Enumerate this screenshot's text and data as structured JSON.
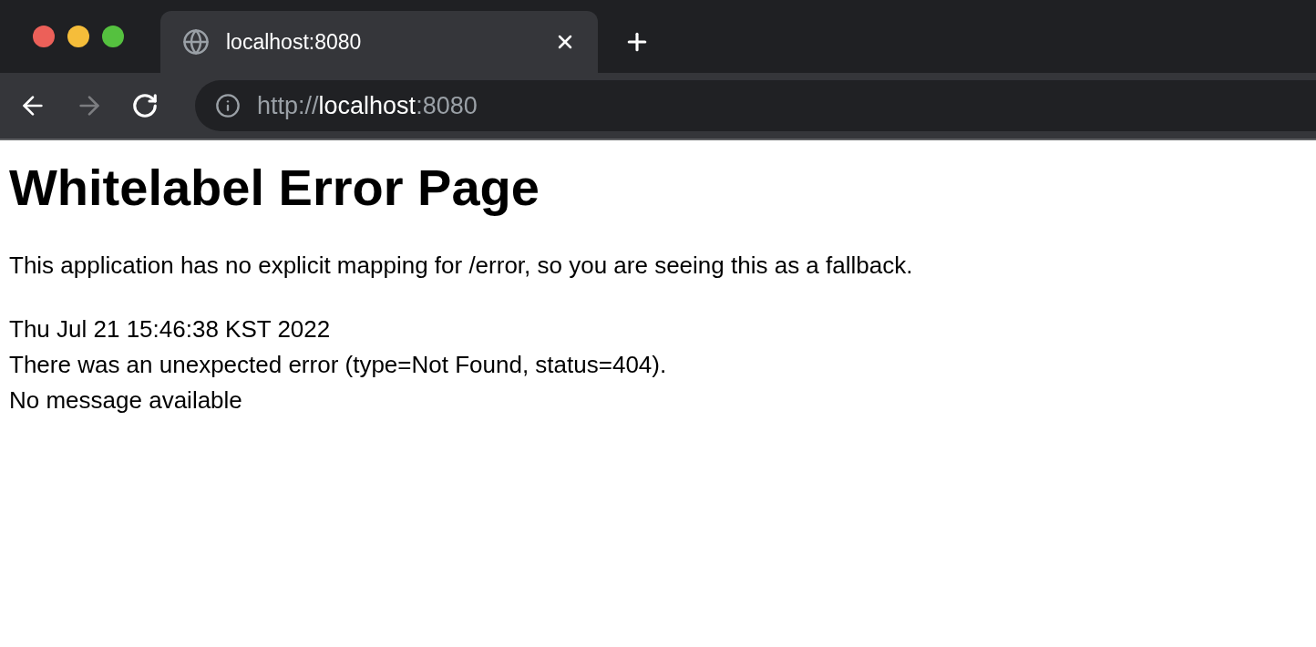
{
  "tabs": [
    {
      "title": "localhost:8080",
      "selected": true
    }
  ],
  "toolbar": {
    "back_disabled": false,
    "forward_disabled": true,
    "url": {
      "scheme": "http://",
      "host": "localhost",
      "port": ":8080"
    }
  },
  "page": {
    "heading": "Whitelabel Error Page",
    "intro": "This application has no explicit mapping for /error, so you are seeing this as a fallback.",
    "lines": [
      "Thu Jul 21 15:46:38 KST 2022",
      "There was an unexpected error (type=Not Found, status=404).",
      "No message available"
    ]
  }
}
